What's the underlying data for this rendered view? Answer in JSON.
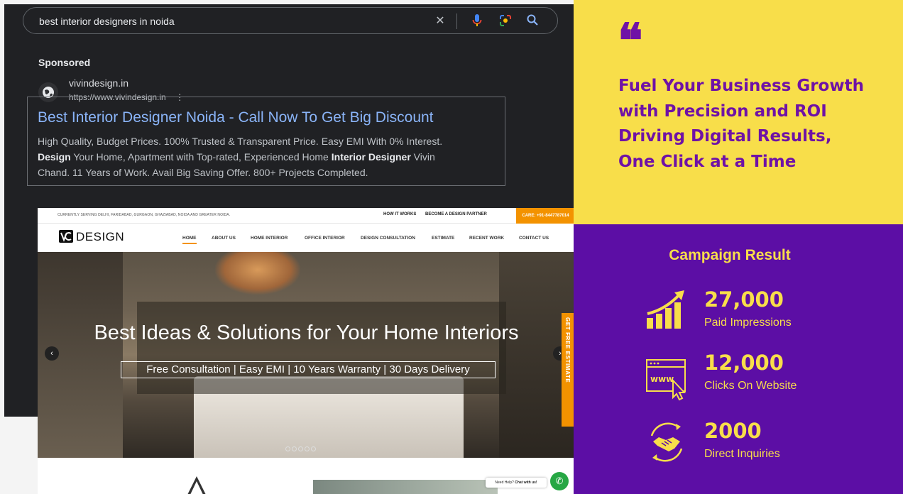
{
  "search": {
    "query": "best interior designers in noida",
    "sponsored_label": "Sponsored",
    "site_name": "vivindesign.in",
    "site_url": "https://www.vivindesign.in",
    "menu_glyph": "⋮",
    "ad_title": "Best Interior Designer Noida - Call Now To Get Big Discount",
    "ad_desc_1": "High Quality, Budget Prices. 100% Trusted & Transparent Price. Easy EMI With 0% Interest.",
    "ad_desc_2a": "Design",
    "ad_desc_2b": " Your Home, Apartment with Top-rated, Experienced Home ",
    "ad_desc_2c": "Interior Designer",
    "ad_desc_2d": " Vivin",
    "ad_desc_3": "Chand. 11 Years of Work. Avail Big Saving Offer. 800+ Projects Completed."
  },
  "website": {
    "serving_text": "CURRENTLY SERVING DELHI, FARIDABAD, GURGAON, GHAZIABAD, NOIDA AND GREATER NOIDA.",
    "top_links": [
      "HOW IT WORKS",
      "BECOME A DESIGN PARTNER"
    ],
    "care": "CARE: +91-8447787014",
    "logo_text": "DESIGN",
    "nav": [
      "HOME",
      "ABOUT US",
      "HOME INTERIOR",
      "OFFICE INTERIOR",
      "DESIGN CONSULTATION",
      "ESTIMATE",
      "RECENT WORK",
      "CONTACT US"
    ],
    "hero_title": "Best Ideas & Solutions for Your Home Interiors",
    "hero_sub": "Free Consultation | Easy EMI | 10 Years Warranty | 30 Days Delivery",
    "estimate_tab": "GET FREE ESTIMATE",
    "chat_prefix": "Need Help? ",
    "chat_label": "Chat with us!"
  },
  "testimonial": {
    "quote_glyph": "❝",
    "line1": "Fuel Your Business Growth",
    "line2": "with Precision and ROI",
    "line3": "Driving Digital Results,",
    "line4": "One Click at a Time"
  },
  "results": {
    "title": "Campaign Result",
    "metrics": [
      {
        "value": "27,000",
        "label": "Paid Impressions",
        "icon": "growth-chart-icon"
      },
      {
        "value": "12,000",
        "label": "Clicks On Website",
        "icon": "www-click-icon"
      },
      {
        "value": "2000",
        "label": "Direct Inquiries",
        "icon": "handshake-icon"
      }
    ]
  },
  "colors": {
    "yellow": "#f8de4a",
    "purple": "#5c0ea5",
    "accent_orange": "#f39200",
    "google_link": "#8ab4f8"
  }
}
